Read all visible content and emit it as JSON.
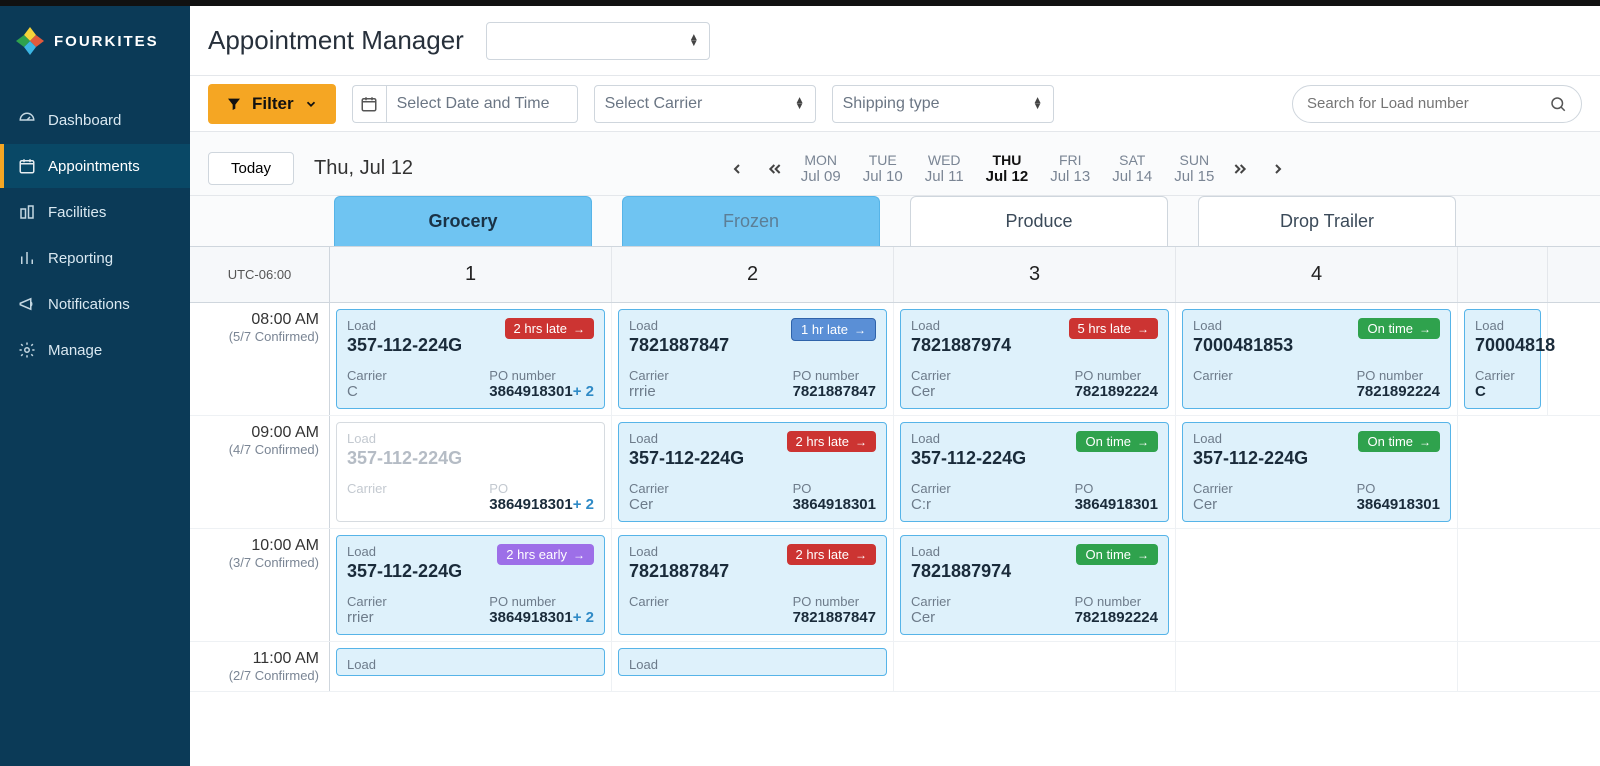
{
  "brand": "FOURKITES",
  "nav": [
    {
      "label": "Dashboard"
    },
    {
      "label": "Appointments"
    },
    {
      "label": "Facilities"
    },
    {
      "label": "Reporting"
    },
    {
      "label": "Notifications"
    },
    {
      "label": "Manage"
    }
  ],
  "page_title": "Appointment Manager",
  "facility_select": "",
  "filter_btn": "Filter",
  "date_time_ph": "Select Date and Time",
  "carrier_ph": "Select Carrier",
  "shiptype_ph": "Shipping type",
  "search_ph": "Search for Load number",
  "today_btn": "Today",
  "current_date": "Thu, Jul 12",
  "days": [
    {
      "wd": "MON",
      "dt": "Jul 09"
    },
    {
      "wd": "TUE",
      "dt": "Jul 10"
    },
    {
      "wd": "WED",
      "dt": "Jul 11"
    },
    {
      "wd": "THU",
      "dt": "Jul 12"
    },
    {
      "wd": "FRI",
      "dt": "Jul 13"
    },
    {
      "wd": "SAT",
      "dt": "Jul 14"
    },
    {
      "wd": "SUN",
      "dt": "Jul 15"
    }
  ],
  "docktabs": [
    {
      "label": "Grocery"
    },
    {
      "label": "Frozen"
    },
    {
      "label": "Produce"
    },
    {
      "label": "Drop Trailer"
    }
  ],
  "tz": "UTC-06:00",
  "columns": [
    "1",
    "2",
    "3",
    "4"
  ],
  "labels": {
    "load": "Load",
    "carrier": "Carrier",
    "po_number": "PO number",
    "po": "PO"
  },
  "badges": {
    "hrs2_late": "2 hrs late",
    "hr1_late": "1 hr late",
    "hrs5_late": "5 hrs late",
    "on_time": "On time",
    "hrs2_early": "2 hrs early"
  },
  "rows": [
    {
      "time": "08:00 AM",
      "conf": "(5/7 Confirmed)",
      "slots": [
        {
          "load": "357-112-224G",
          "badge": "hrs2_late",
          "badge_cls": "b-red",
          "carrier": "C",
          "po": "3864918301",
          "plus": "+ 2",
          "po_lbl": "po_number"
        },
        {
          "load": "7821887847",
          "badge": "hr1_late",
          "badge_cls": "b-blue",
          "carrier": "rrrie",
          "po": "7821887847",
          "po_lbl": "po_number"
        },
        {
          "load": "7821887974",
          "badge": "hrs5_late",
          "badge_cls": "b-red",
          "carrier": "Cer",
          "po": "7821892224",
          "po_lbl": "po_number"
        },
        {
          "load": "7000481853",
          "badge": "on_time",
          "badge_cls": "b-green",
          "carrier": "",
          "po": "7821892224",
          "po_lbl": "po_number"
        },
        {
          "load": "70004818",
          "carrier": "C",
          "po_lbl": "po_number",
          "partial": true
        }
      ]
    },
    {
      "time": "09:00 AM",
      "conf": "(4/7 Confirmed)",
      "slots": [
        {
          "load": "357-112-224G",
          "dim": true,
          "carrier": "",
          "po": "3864918301",
          "plus": "+ 2",
          "po_lbl": "po"
        },
        {
          "load": "357-112-224G",
          "badge": "hrs2_late",
          "badge_cls": "b-red",
          "carrier": "Cer",
          "po": "3864918301",
          "po_lbl": "po"
        },
        {
          "load": "357-112-224G",
          "badge": "on_time",
          "badge_cls": "b-green",
          "carrier": "C:r",
          "po": "3864918301",
          "po_lbl": "po"
        },
        {
          "load": "357-112-224G",
          "badge": "on_time",
          "badge_cls": "b-green",
          "carrier": "Cer",
          "po": "3864918301",
          "po_lbl": "po"
        }
      ]
    },
    {
      "time": "10:00 AM",
      "conf": "(3/7 Confirmed)",
      "slots": [
        {
          "load": "357-112-224G",
          "badge": "hrs2_early",
          "badge_cls": "b-purple",
          "carrier": "rrier",
          "po": "3864918301",
          "plus": "+ 2",
          "po_lbl": "po_number"
        },
        {
          "load": "7821887847",
          "badge": "hrs2_late",
          "badge_cls": "b-red",
          "carrier": "",
          "po": "7821887847",
          "po_lbl": "po_number"
        },
        {
          "load": "7821887974",
          "badge": "on_time",
          "badge_cls": "b-green",
          "carrier": "Cer",
          "po": "7821892224",
          "po_lbl": "po_number"
        },
        {
          "empty": true
        }
      ]
    },
    {
      "time": "11:00 AM",
      "conf": "(2/7 Confirmed)",
      "slots": [
        {
          "load_only": true
        },
        {
          "load_only": true
        },
        {
          "empty": true
        },
        {
          "empty": true
        }
      ]
    }
  ]
}
